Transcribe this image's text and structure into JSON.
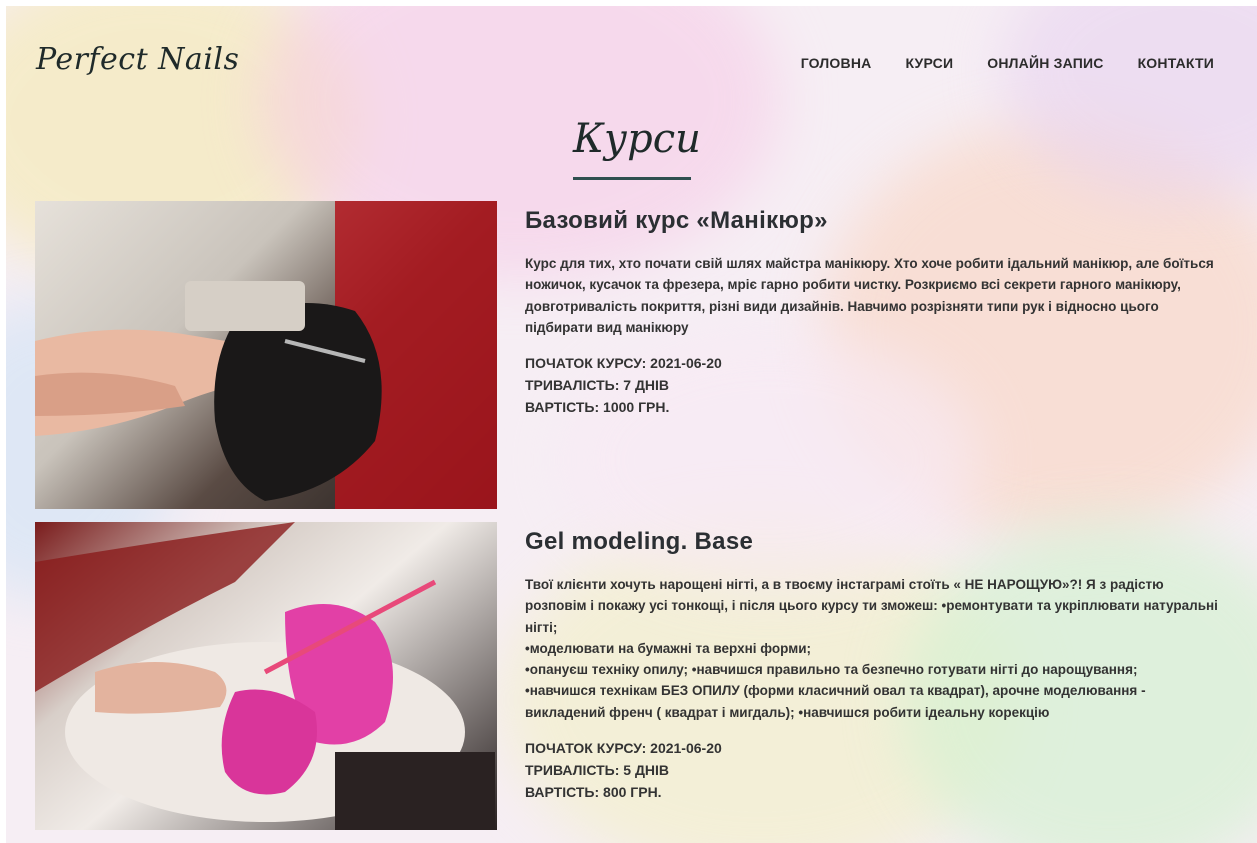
{
  "header": {
    "logo": "Perfect Nails",
    "nav": [
      "ГОЛОВНА",
      "КУРСИ",
      "ОНЛАЙН ЗАПИС",
      "КОНТАКТИ"
    ]
  },
  "page_title": "Курси",
  "courses": [
    {
      "title": "Базовий курс «Манікюр»",
      "description": "Курс для тих, хто почати свій шлях майстра манікюру. Хто хоче робити ідальний манікюр, але боїться ножичок, кусачок та фрезера, мріє гарно робити чистку. Розкриємо всі секрети гарного манікюру, довготривалість покриття, різні види дизайнів. Навчимо розрізняти типи рук і відносно цього підбирати вид манікюру",
      "start": "ПОЧАТОК КУРСУ: 2021-06-20",
      "duration": "ТРИВАЛІСТЬ: 7 ДНІВ",
      "price": "ВАРТІСТЬ: 1000 ГРН."
    },
    {
      "title": "Gel modeling. Base",
      "description": "Твої клієнти хочуть нарощені нігті, а в твоєму інстаграмі стоїть « НЕ НАРОЩУЮ»?! Я з радістю розповім і покажу усі тонкощі, і після цього курсу ти зможеш: •ремонтувати та укріплювати натуральні нігті;\n•моделювати на бумажні та верхні форми;\n•опануєш техніку опилу; •навчишся правильно та безпечно готувати нігті до нарощування;\n•навчишся технікам БЕЗ ОПИЛУ (форми класичний овал та квадрат), арочне моделювання - викладений френч ( квадрат і мигдаль); •навчишся робити ідеальну корекцію",
      "start": "ПОЧАТОК КУРСУ: 2021-06-20",
      "duration": "ТРИВАЛІСТЬ: 5 ДНІВ",
      "price": "ВАРТІСТЬ: 800 ГРН."
    }
  ],
  "colors": {
    "text": "#333333",
    "heading": "#2b2f33",
    "accent": "#2f4f4f"
  }
}
